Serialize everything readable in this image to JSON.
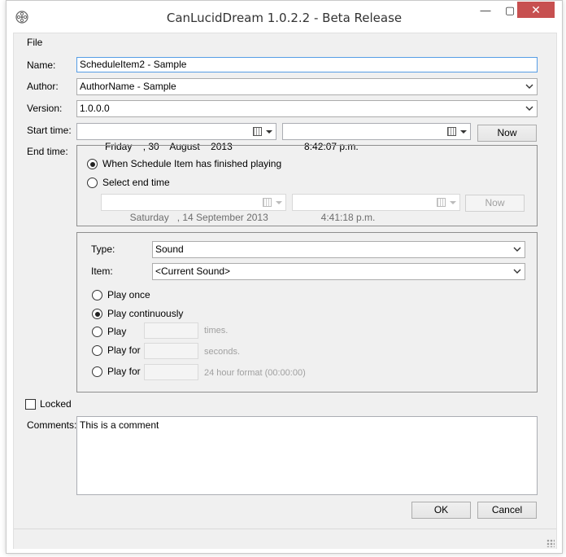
{
  "window": {
    "title": "CanLucidDream 1.0.2.2 - Beta Release",
    "minimize_glyph": "—",
    "maximize_glyph": "▢",
    "close_glyph": "✕"
  },
  "menu": {
    "file": "File"
  },
  "form": {
    "name_label": "Name:",
    "name_value": "ScheduleItem2 - Sample",
    "author_label": "Author:",
    "author_value": "AuthorName - Sample",
    "version_label": "Version:",
    "version_value": "1.0.0.0",
    "start_label": "Start time:",
    "start_date": "Friday    , 30    August    2013",
    "start_time": "8:42:07 p.m.",
    "now_label": "Now",
    "end_label": "End time:",
    "end_option_finished": "When Schedule Item has finished playing",
    "end_option_select": "Select end time",
    "end_date": "Saturday   , 14 September 2013",
    "end_time": "4:41:18 p.m.",
    "end_now_label": "Now"
  },
  "playback": {
    "type_label": "Type:",
    "type_value": "Sound",
    "item_label": "Item:",
    "item_value": "<Current Sound>",
    "play_once": "Play once",
    "play_continuously": "Play continuously",
    "play_times": "Play",
    "times_suffix": "times.",
    "play_for_seconds": "Play for",
    "seconds_suffix": "seconds.",
    "play_for_format": "Play for",
    "format_suffix": "24 hour format (00:00:00)"
  },
  "bottom": {
    "locked_label": "Locked",
    "comments_label": "Comments:",
    "comments_value": "This is a comment",
    "ok_label": "OK",
    "cancel_label": "Cancel"
  }
}
